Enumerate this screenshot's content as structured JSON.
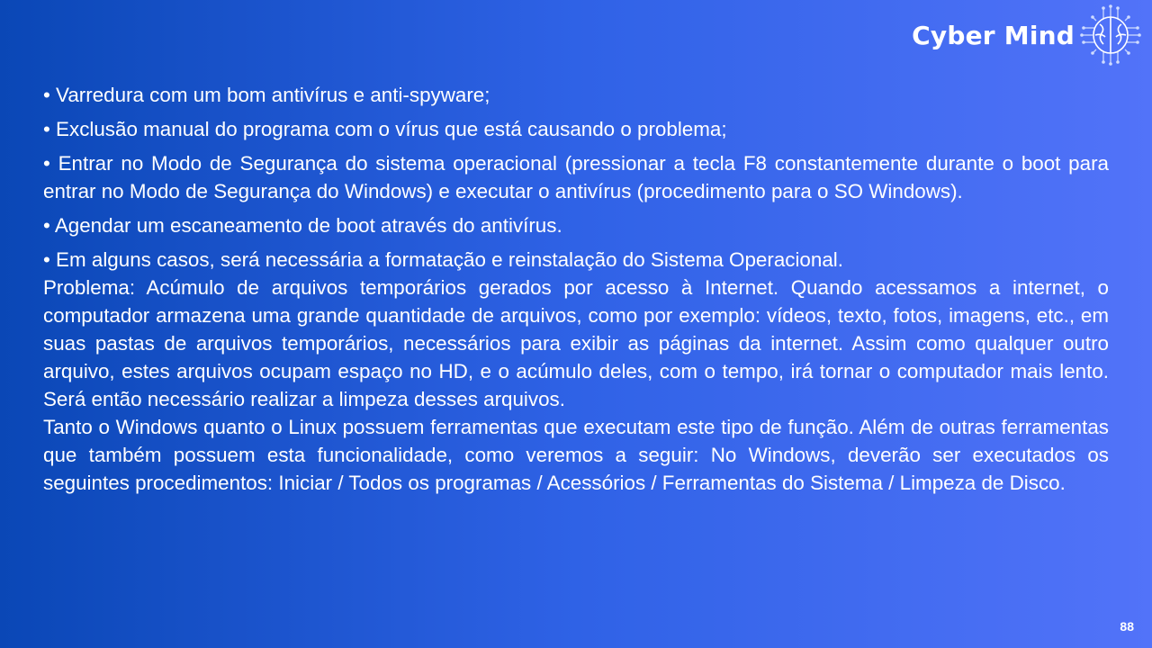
{
  "logo": {
    "text": "Cyber Mind",
    "icon": "brain-circuit-icon"
  },
  "bullets": [
    "• Varredura com um bom antivírus e anti-spyware;",
    "• Exclusão manual do programa com o vírus que está causando o problema;",
    "• Entrar no Modo de Segurança do sistema operacional (pressionar a tecla F8 constantemente durante o boot para entrar no Modo de Segurança do Windows) e executar o antivírus (procedimento para o SO Windows).",
    "• Agendar um escaneamento de boot através do antivírus.",
    "• Em alguns casos, será necessária a formatação e reinstalação do Sistema Operacional."
  ],
  "paragraphs": [
    "Problema: Acúmulo de arquivos temporários gerados por acesso à Internet. Quando acessamos a internet, o computador armazena uma grande quantidade de arquivos, como por exemplo: vídeos, texto, fotos, imagens, etc., em suas pastas de arquivos temporários, necessários para exibir as páginas da internet. Assim como qualquer outro arquivo, estes arquivos ocupam espaço no HD, e o acúmulo deles, com o tempo, irá tornar o computador mais lento. Será então necessário realizar a limpeza desses arquivos.",
    "Tanto o Windows quanto o Linux possuem ferramentas que executam este tipo de função. Além de outras ferramentas que também possuem esta funcionalidade, como veremos a seguir: No Windows, deverão ser executados os seguintes procedimentos: Iniciar / Todos os programas / Acessórios / Ferramentas do Sistema / Limpeza de Disco."
  ],
  "page_number": "88",
  "colors": {
    "background_start": "#0a47b6",
    "background_end": "#5273f9",
    "text": "#ffffff"
  }
}
